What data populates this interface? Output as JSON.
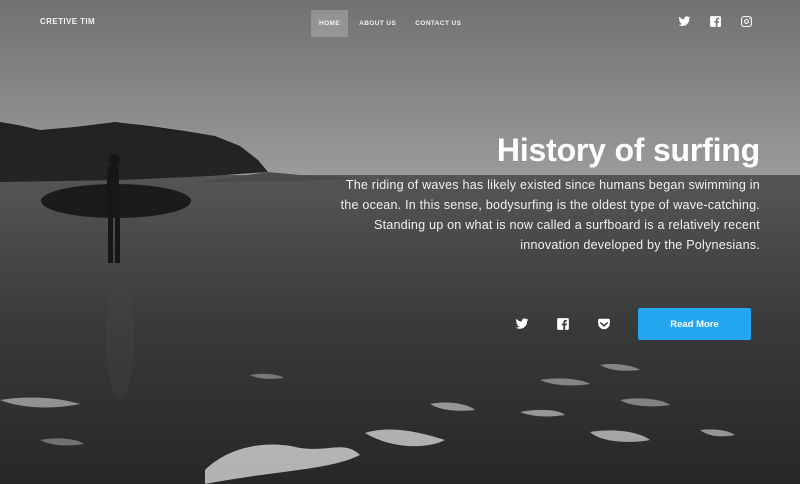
{
  "brand": "CRETIVE TIM",
  "nav": {
    "items": [
      {
        "label": "HOME",
        "active": true
      },
      {
        "label": "ABOUT US",
        "active": false
      },
      {
        "label": "CONTACT US",
        "active": false
      }
    ],
    "social": [
      "twitter-icon",
      "facebook-icon",
      "instagram-icon"
    ]
  },
  "hero": {
    "title": "History of surfing",
    "description": "The riding of waves has likely existed since humans began swimming in the ocean. In this sense, bodysurfing is the oldest type of wave-catching. Standing up on what is now called a surfboard is a relatively recent innovation developed by the Polynesians.",
    "share_icons": [
      "twitter-icon",
      "facebook-icon",
      "pocket-icon"
    ],
    "button_label": "Read More"
  },
  "colors": {
    "accent": "#22a7f0",
    "text": "#ffffff"
  }
}
